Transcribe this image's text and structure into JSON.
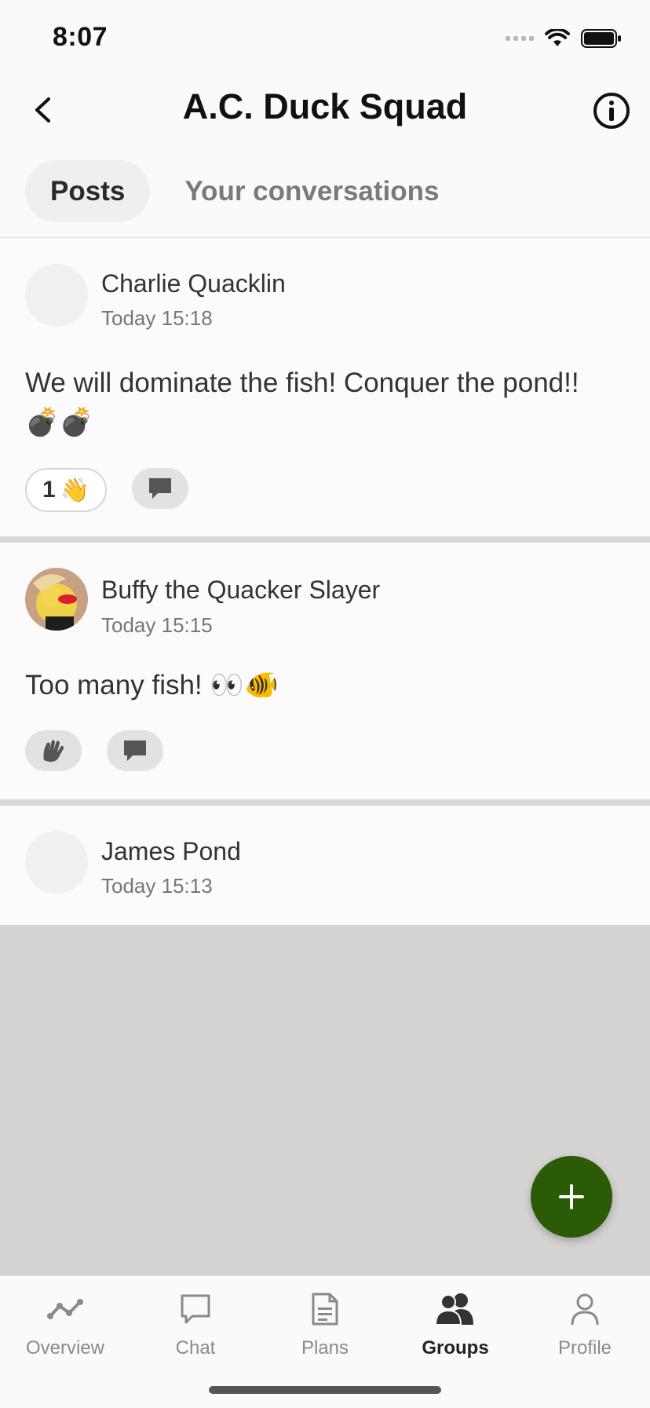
{
  "status": {
    "time": "8:07"
  },
  "header": {
    "title": "A.C. Duck Squad"
  },
  "tabs": [
    {
      "label": "Posts",
      "active": true
    },
    {
      "label": "Your conversations",
      "active": false
    }
  ],
  "posts": [
    {
      "author": "Charlie Quacklin",
      "time": "Today 15:18",
      "text": "We will dominate the fish! Conquer the pond!! 💣💣",
      "reaction_count": "1",
      "reaction_emoji": "👋"
    },
    {
      "author": "Buffy the Quacker Slayer",
      "time": "Today 15:15",
      "text": "Too many fish! 👀🐠"
    },
    {
      "author": "James Pond",
      "time": "Today 15:13"
    }
  ],
  "nav": [
    {
      "label": "Overview",
      "icon": "overview-icon"
    },
    {
      "label": "Chat",
      "icon": "chat-icon"
    },
    {
      "label": "Plans",
      "icon": "plans-icon"
    },
    {
      "label": "Groups",
      "icon": "groups-icon",
      "active": true
    },
    {
      "label": "Profile",
      "icon": "profile-icon"
    }
  ],
  "colors": {
    "fab": "#2b5b07",
    "background": "#d4d3d2"
  }
}
